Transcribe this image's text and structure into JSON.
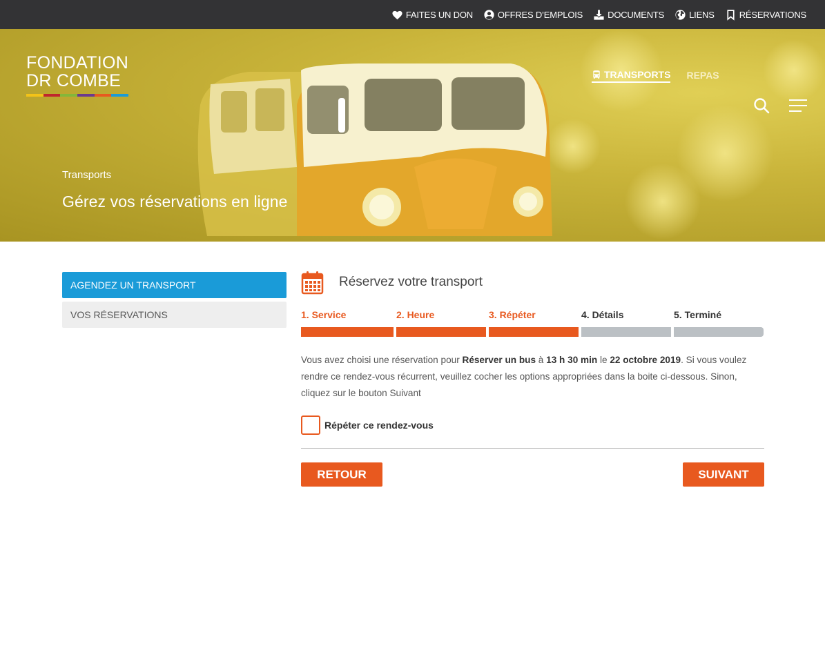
{
  "topbar": {
    "links": [
      {
        "label": "FAITES UN DON",
        "icon": "heart-icon"
      },
      {
        "label": "OFFRES D’EMPLOIS",
        "icon": "user-circle-icon"
      },
      {
        "label": "DOCUMENTS",
        "icon": "download-icon"
      },
      {
        "label": "LIENS",
        "icon": "globe-icon"
      },
      {
        "label": "RÉSERVATIONS",
        "icon": "bookmark-icon"
      }
    ]
  },
  "brand": {
    "line1": "FONDATION",
    "line2": "DR COMBE",
    "bar_colors": [
      "#f3c318",
      "#c0262d",
      "#83b73a",
      "#6b3a8e",
      "#e8591f",
      "#1a9bd8"
    ]
  },
  "mainnav": {
    "items": [
      {
        "label": "TRANSPORTS",
        "icon": "bus-icon",
        "active": true
      },
      {
        "label": "REPAS",
        "active": false
      }
    ]
  },
  "hero": {
    "breadcrumb": "Transports",
    "title": "Gérez vos réservations en ligne"
  },
  "sidebar": {
    "items": [
      {
        "label": "AGENDEZ UN TRANSPORT",
        "active": true
      },
      {
        "label": "VOS RÉSERVATIONS",
        "active": false
      }
    ]
  },
  "main": {
    "heading": "Réservez votre transport",
    "heading_icon": "calendar-icon",
    "steps": [
      {
        "label": "1. Service",
        "status": "done"
      },
      {
        "label": "2. Heure",
        "status": "done"
      },
      {
        "label": "3. Répéter",
        "status": "done"
      },
      {
        "label": "4. Détails",
        "status": "todo"
      },
      {
        "label": "5. Terminé",
        "status": "todo"
      }
    ],
    "description": {
      "part1": "Vous avez choisi une réservation pour ",
      "service": "Réserver un bus",
      "part2": " à ",
      "time": "13 h 30 min",
      "part3": " le ",
      "date": "22 octobre 2019",
      "part4": ". Si vous voulez rendre ce rendez-vous récurrent, veuillez cocher les options appropriées dans la boite ci-dessous. Sinon, cliquez sur le bouton Suivant"
    },
    "repeat_label": "Répéter ce rendez-vous",
    "repeat_checked": false,
    "back_label": "RETOUR",
    "next_label": "SUIVANT"
  },
  "colors": {
    "accent": "#e8591f",
    "primary_blue": "#1a9bd8",
    "topbar": "#333335",
    "step_inactive": "#bbc0c4"
  }
}
